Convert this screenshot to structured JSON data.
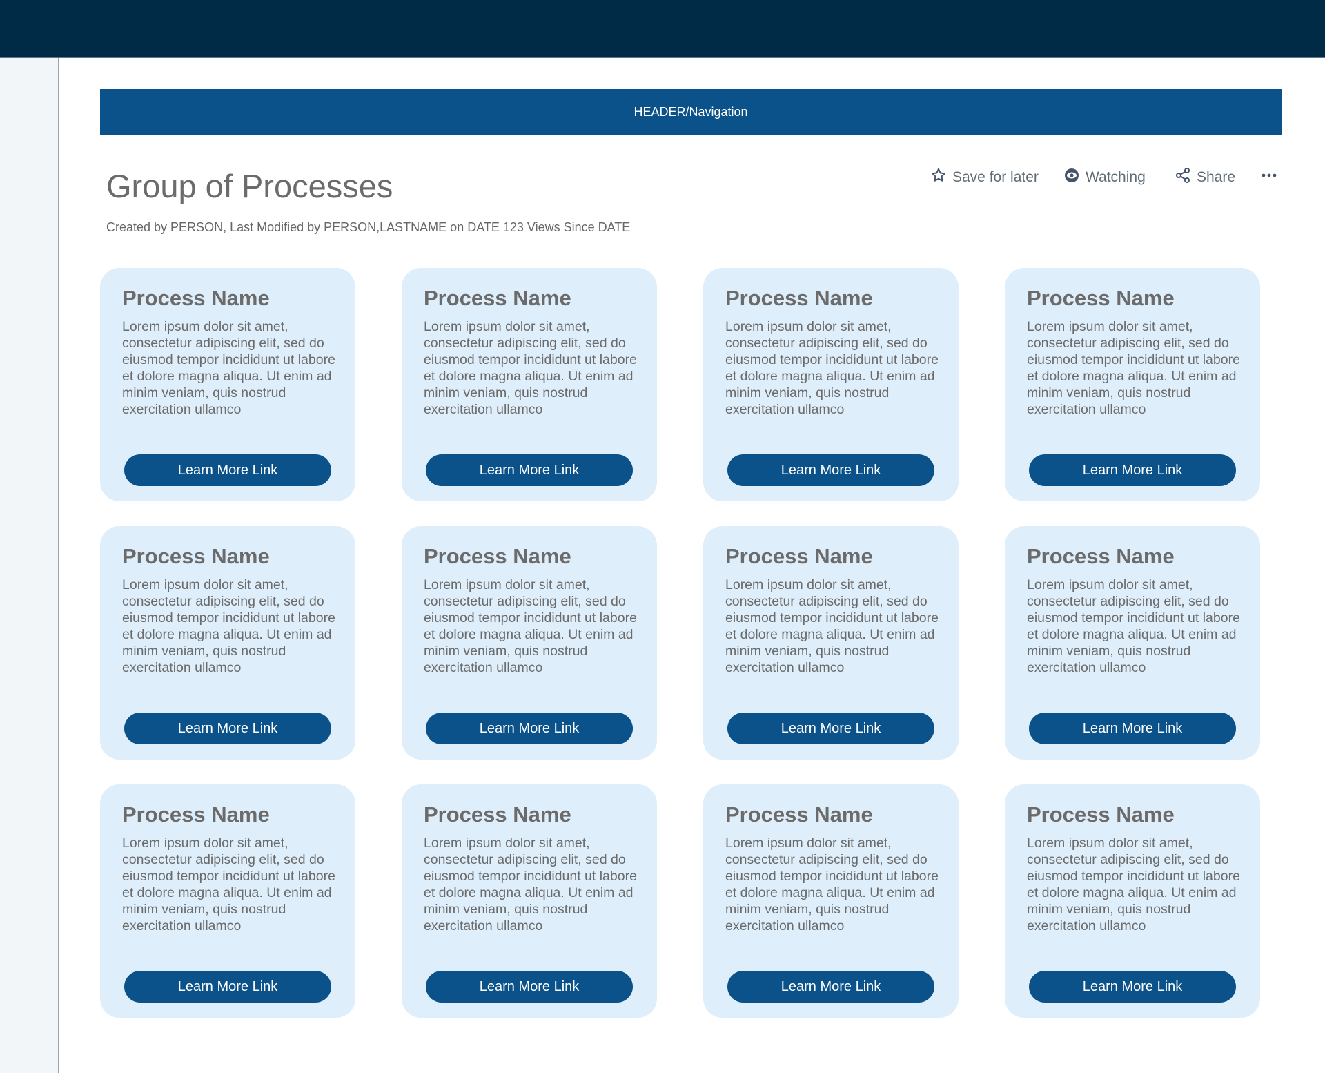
{
  "header": {
    "nav_label": "HEADER/Navigation"
  },
  "page": {
    "title": "Group of Processes",
    "meta": "Created by PERSON, Last Modified by PERSON,LASTNAME on DATE 123 Views Since DATE"
  },
  "actions": {
    "save": "Save for later",
    "watching": "Watching",
    "share": "Share"
  },
  "colors": {
    "topbar": "#002b47",
    "accent": "#0a5289",
    "card_bg": "#deeefb"
  },
  "cards": [
    {
      "title": "Process Name",
      "description": "Lorem ipsum dolor sit amet, consectetur adipiscing elit, sed do eiusmod tempor incididunt ut labore et dolore magna aliqua. Ut enim ad minim veniam, quis nostrud exercitation ullamco",
      "button": "Learn More Link"
    },
    {
      "title": "Process Name",
      "description": "Lorem ipsum dolor sit amet, consectetur adipiscing elit, sed do eiusmod tempor incididunt ut labore et dolore magna aliqua. Ut enim ad minim veniam, quis nostrud exercitation ullamco",
      "button": "Learn More Link"
    },
    {
      "title": "Process Name",
      "description": "Lorem ipsum dolor sit amet, consectetur adipiscing elit, sed do eiusmod tempor incididunt ut labore et dolore magna aliqua. Ut enim ad minim veniam, quis nostrud exercitation ullamco",
      "button": "Learn More Link"
    },
    {
      "title": "Process Name",
      "description": "Lorem ipsum dolor sit amet, consectetur adipiscing elit, sed do eiusmod tempor incididunt ut labore et dolore magna aliqua. Ut enim ad minim veniam, quis nostrud exercitation ullamco",
      "button": "Learn More Link"
    },
    {
      "title": "Process Name",
      "description": "Lorem ipsum dolor sit amet, consectetur adipiscing elit, sed do eiusmod tempor incididunt ut labore et dolore magna aliqua. Ut enim ad minim veniam, quis nostrud exercitation ullamco",
      "button": "Learn More Link"
    },
    {
      "title": "Process Name",
      "description": "Lorem ipsum dolor sit amet, consectetur adipiscing elit, sed do eiusmod tempor incididunt ut labore et dolore magna aliqua. Ut enim ad minim veniam, quis nostrud exercitation ullamco",
      "button": "Learn More Link"
    },
    {
      "title": "Process Name",
      "description": "Lorem ipsum dolor sit amet, consectetur adipiscing elit, sed do eiusmod tempor incididunt ut labore et dolore magna aliqua. Ut enim ad minim veniam, quis nostrud exercitation ullamco",
      "button": "Learn More Link"
    },
    {
      "title": "Process Name",
      "description": "Lorem ipsum dolor sit amet, consectetur adipiscing elit, sed do eiusmod tempor incididunt ut labore et dolore magna aliqua. Ut enim ad minim veniam, quis nostrud exercitation ullamco",
      "button": "Learn More Link"
    },
    {
      "title": "Process Name",
      "description": "Lorem ipsum dolor sit amet, consectetur adipiscing elit, sed do eiusmod tempor incididunt ut labore et dolore magna aliqua. Ut enim ad minim veniam, quis nostrud exercitation ullamco",
      "button": "Learn More Link"
    },
    {
      "title": "Process Name",
      "description": "Lorem ipsum dolor sit amet, consectetur adipiscing elit, sed do eiusmod tempor incididunt ut labore et dolore magna aliqua. Ut enim ad minim veniam, quis nostrud exercitation ullamco",
      "button": "Learn More Link"
    },
    {
      "title": "Process Name",
      "description": "Lorem ipsum dolor sit amet, consectetur adipiscing elit, sed do eiusmod tempor incididunt ut labore et dolore magna aliqua. Ut enim ad minim veniam, quis nostrud exercitation ullamco",
      "button": "Learn More Link"
    },
    {
      "title": "Process Name",
      "description": "Lorem ipsum dolor sit amet, consectetur adipiscing elit, sed do eiusmod tempor incididunt ut labore et dolore magna aliqua. Ut enim ad minim veniam, quis nostrud exercitation ullamco",
      "button": "Learn More Link"
    }
  ]
}
